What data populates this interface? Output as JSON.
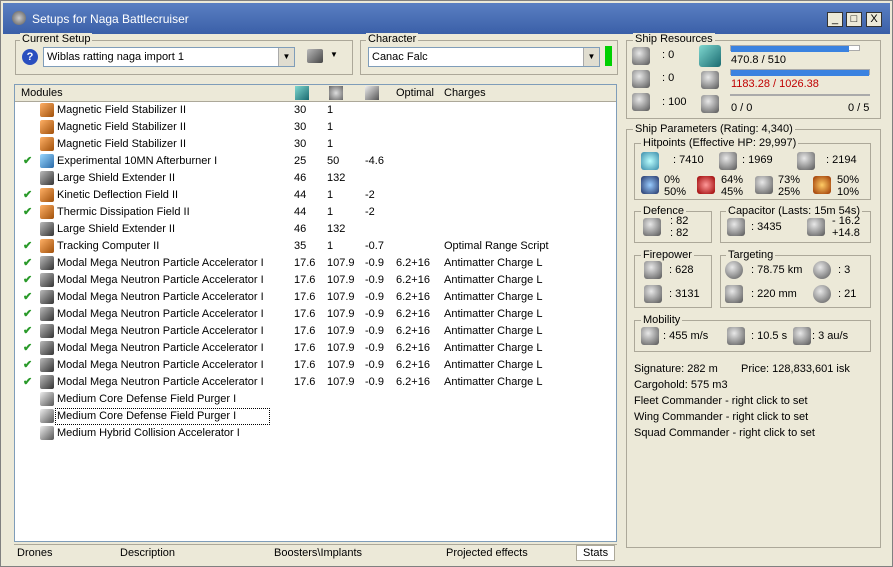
{
  "title": "Setups for Naga Battlecruiser",
  "title_buttons": {
    "min": "_",
    "max": "□",
    "close": "X"
  },
  "current_setup": {
    "label": "Current Setup",
    "value": "Wiblas ratting naga import 1"
  },
  "character": {
    "label": "Character",
    "value": "Canac Falc"
  },
  "modules_header": {
    "name": "Modules",
    "optimal": "Optimal",
    "charges": "Charges"
  },
  "modules": [
    {
      "name": "Magnetic Field Stabilizer II",
      "c1": "30",
      "c2": "1",
      "c3": "",
      "opt": "",
      "charge": "",
      "active": false,
      "icon": "orange"
    },
    {
      "name": "Magnetic Field Stabilizer II",
      "c1": "30",
      "c2": "1",
      "c3": "",
      "opt": "",
      "charge": "",
      "active": false,
      "icon": "orange"
    },
    {
      "name": "Magnetic Field Stabilizer II",
      "c1": "30",
      "c2": "1",
      "c3": "",
      "opt": "",
      "charge": "",
      "active": false,
      "icon": "orange"
    },
    {
      "name": "Experimental 10MN Afterburner I",
      "c1": "25",
      "c2": "50",
      "c3": "-4.6",
      "opt": "",
      "charge": "",
      "active": true,
      "icon": "blue"
    },
    {
      "name": "Large Shield Extender II",
      "c1": "46",
      "c2": "132",
      "c3": "",
      "opt": "",
      "charge": "",
      "active": false,
      "icon": "gray"
    },
    {
      "name": "Kinetic Deflection Field II",
      "c1": "44",
      "c2": "1",
      "c3": "-2",
      "opt": "",
      "charge": "",
      "active": true,
      "icon": "orange"
    },
    {
      "name": "Thermic Dissipation Field II",
      "c1": "44",
      "c2": "1",
      "c3": "-2",
      "opt": "",
      "charge": "",
      "active": true,
      "icon": "orange"
    },
    {
      "name": "Large Shield Extender II",
      "c1": "46",
      "c2": "132",
      "c3": "",
      "opt": "",
      "charge": "",
      "active": false,
      "icon": "gray"
    },
    {
      "name": "Tracking Computer II",
      "c1": "35",
      "c2": "1",
      "c3": "-0.7",
      "opt": "",
      "charge": "Optimal Range Script",
      "active": true,
      "icon": "orange"
    },
    {
      "name": "Modal Mega Neutron Particle Accelerator I",
      "c1": "17.6",
      "c2": "107.9",
      "c3": "-0.9",
      "opt": "6.2+16",
      "charge": "Antimatter Charge L",
      "active": true,
      "icon": "gray"
    },
    {
      "name": "Modal Mega Neutron Particle Accelerator I",
      "c1": "17.6",
      "c2": "107.9",
      "c3": "-0.9",
      "opt": "6.2+16",
      "charge": "Antimatter Charge L",
      "active": true,
      "icon": "gray"
    },
    {
      "name": "Modal Mega Neutron Particle Accelerator I",
      "c1": "17.6",
      "c2": "107.9",
      "c3": "-0.9",
      "opt": "6.2+16",
      "charge": "Antimatter Charge L",
      "active": true,
      "icon": "gray"
    },
    {
      "name": "Modal Mega Neutron Particle Accelerator I",
      "c1": "17.6",
      "c2": "107.9",
      "c3": "-0.9",
      "opt": "6.2+16",
      "charge": "Antimatter Charge L",
      "active": true,
      "icon": "gray"
    },
    {
      "name": "Modal Mega Neutron Particle Accelerator I",
      "c1": "17.6",
      "c2": "107.9",
      "c3": "-0.9",
      "opt": "6.2+16",
      "charge": "Antimatter Charge L",
      "active": true,
      "icon": "gray"
    },
    {
      "name": "Modal Mega Neutron Particle Accelerator I",
      "c1": "17.6",
      "c2": "107.9",
      "c3": "-0.9",
      "opt": "6.2+16",
      "charge": "Antimatter Charge L",
      "active": true,
      "icon": "gray"
    },
    {
      "name": "Modal Mega Neutron Particle Accelerator I",
      "c1": "17.6",
      "c2": "107.9",
      "c3": "-0.9",
      "opt": "6.2+16",
      "charge": "Antimatter Charge L",
      "active": true,
      "icon": "gray"
    },
    {
      "name": "Modal Mega Neutron Particle Accelerator I",
      "c1": "17.6",
      "c2": "107.9",
      "c3": "-0.9",
      "opt": "6.2+16",
      "charge": "Antimatter Charge L",
      "active": true,
      "icon": "gray"
    },
    {
      "name": "Medium Core Defense Field Purger I",
      "c1": "",
      "c2": "",
      "c3": "",
      "opt": "",
      "charge": "",
      "active": false,
      "icon": "shield"
    },
    {
      "name": "Medium Core Defense Field Purger I",
      "c1": "",
      "c2": "",
      "c3": "",
      "opt": "",
      "charge": "",
      "active": false,
      "icon": "shield"
    },
    {
      "name": "Medium Hybrid Collision Accelerator I",
      "c1": "",
      "c2": "",
      "c3": "",
      "opt": "",
      "charge": "",
      "active": false,
      "icon": "shield"
    }
  ],
  "bottom_tabs": {
    "drones": "Drones",
    "description": "Description",
    "boosters": "Boosters\\Implants",
    "projected": "Projected effects",
    "stats": "Stats"
  },
  "resources": {
    "label": "Ship Resources",
    "hp1": ": 0",
    "hp2": ": 0",
    "hp3": ": 100",
    "cpu": "470.8 / 510",
    "cpu_fill": 0.923,
    "pg": "1183.28 / 1026.38",
    "pg_fill": 1.0,
    "calib": "0 / 0",
    "drones": "0 / 5",
    "colors": {
      "bar": "#3a82e0",
      "over": "#c00000"
    }
  },
  "params": {
    "label": "Ship Parameters (Rating: 4,340)",
    "hp_label": "Hitpoints (Effective HP: 29,997)",
    "shield_hp": ": 7410",
    "armor_hp": ": 1969",
    "hull_hp": ": 2194",
    "em": [
      "0%",
      "50%"
    ],
    "therm": [
      "64%",
      "45%"
    ],
    "kin": [
      "73%",
      "25%"
    ],
    "exp": [
      "50%",
      "10%"
    ],
    "defence_label": "Defence",
    "def1": ": 82",
    "def2": ": 82",
    "cap_label": "Capacitor (Lasts: 15m 54s)",
    "cap_amount": ": 3435",
    "cap_d1": "- 16.2",
    "cap_d2": "+14.8",
    "fire_label": "Firepower",
    "fire1": ": 628",
    "fire2": ": 3131",
    "targ_label": "Targeting",
    "range": ": 78.75 km",
    "targets": ": 3",
    "scan": ": 220 mm",
    "sensor": ": 21",
    "mob_label": "Mobility",
    "speed": ": 455 m/s",
    "align": ": 10.5 s",
    "warp": ": 3 au/s",
    "signature": "Signature: 282 m",
    "price": "Price: 128,833,601 isk",
    "cargo": "Cargohold: 575 m3",
    "fleet": "Fleet Commander - right click to set",
    "wing": "Wing Commander - right click to set",
    "squad": "Squad Commander - right click to set"
  }
}
